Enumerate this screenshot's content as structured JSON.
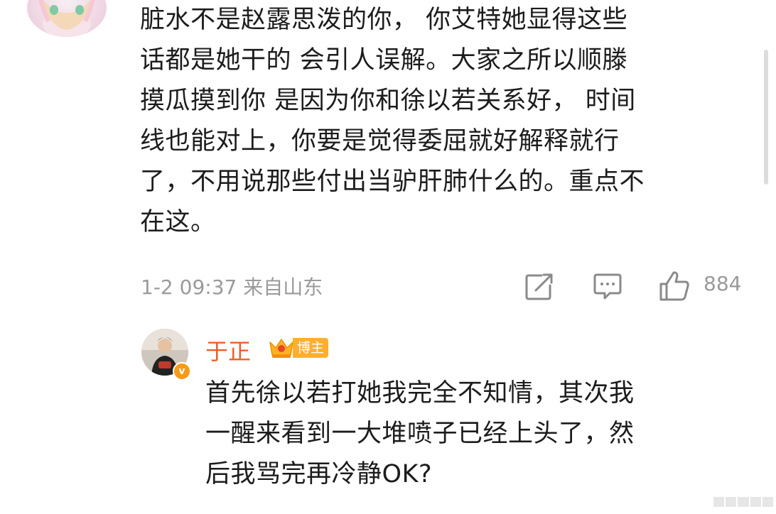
{
  "comment": {
    "lines": [
      "脏水不是赵露思泼的你， 你艾特她显得这些",
      "话都是她干的 会引人误解。大家之所以顺滕",
      "摸瓜摸到你 是因为你和徐以若关系好， 时间",
      "线也能对上，你要是觉得委屈就好解释就行",
      "了，不用说那些付出当驴肝肺什么的。重点不",
      "在这。"
    ],
    "meta": "1-2 09:37 来自山东",
    "like_count": "884",
    "icons": [
      "share-icon",
      "comment-icon",
      "like-icon"
    ]
  },
  "reply": {
    "author": "于正",
    "badge_label": "博主",
    "verified_mark": "v",
    "lines": [
      "首先徐以若打她我完全不知情，其次我",
      "一醒来看到一大堆喷子已经上头了，然",
      "后我骂完再冷静OK?"
    ]
  },
  "colors": {
    "text": "#1c1c1c",
    "meta": "#9a9a9a",
    "author": "#e8612b",
    "badge": "#ffae2e",
    "verified": "#f79a15"
  }
}
